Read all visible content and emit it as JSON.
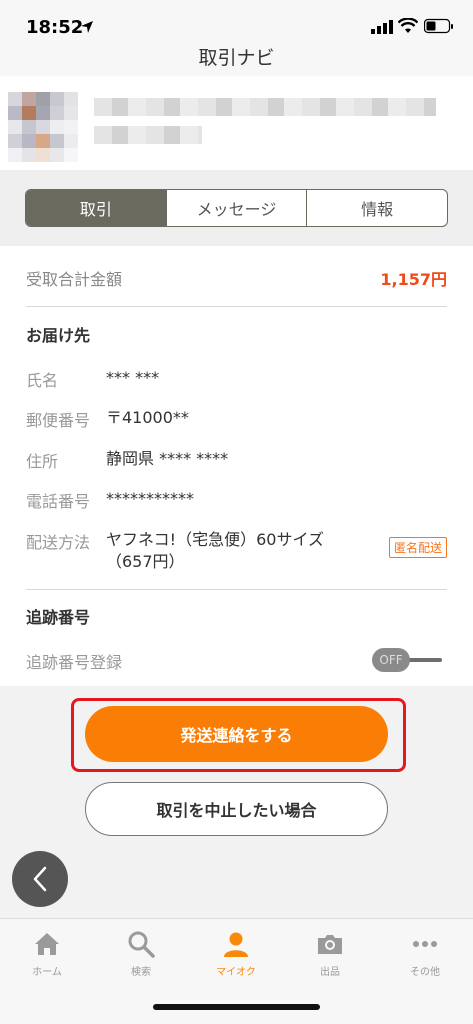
{
  "status_bar": {
    "time": "18:52"
  },
  "nav": {
    "title": "取引ナビ"
  },
  "tabs": [
    {
      "label": "取引",
      "active": true
    },
    {
      "label": "メッセージ",
      "active": false
    },
    {
      "label": "情報",
      "active": false
    }
  ],
  "summary": {
    "label": "受取合計金額",
    "value": "1,157円"
  },
  "delivery": {
    "title": "お届け先",
    "name_label": "氏名",
    "name_value": "*** ***",
    "zip_label": "郵便番号",
    "zip_value": "〒41000**",
    "address_label": "住所",
    "address_value": "静岡県 **** ****",
    "phone_label": "電話番号",
    "phone_value": "***********",
    "method_label": "配送方法",
    "method_value_line1": "ヤフネコ!（宅急便）60サイズ",
    "method_value_line2": "（657円）",
    "anon_badge": "匿名配送"
  },
  "tracking": {
    "title": "追跡番号",
    "register_label": "追跡番号登録",
    "toggle_state": "OFF"
  },
  "actions": {
    "primary": "発送連絡をする",
    "secondary": "取引を中止したい場合"
  },
  "tab_bar": [
    {
      "label": "ホーム",
      "icon": "home-icon",
      "active": false
    },
    {
      "label": "検索",
      "icon": "search-icon",
      "active": false
    },
    {
      "label": "マイオク",
      "icon": "person-icon",
      "active": true
    },
    {
      "label": "出品",
      "icon": "camera-icon",
      "active": false
    },
    {
      "label": "その他",
      "icon": "more-icon",
      "active": false
    }
  ],
  "colors": {
    "accent": "#fa7d05",
    "price": "#f24a1b",
    "highlight_outline": "#e3191f",
    "tab_active": "#6b6a5f"
  }
}
